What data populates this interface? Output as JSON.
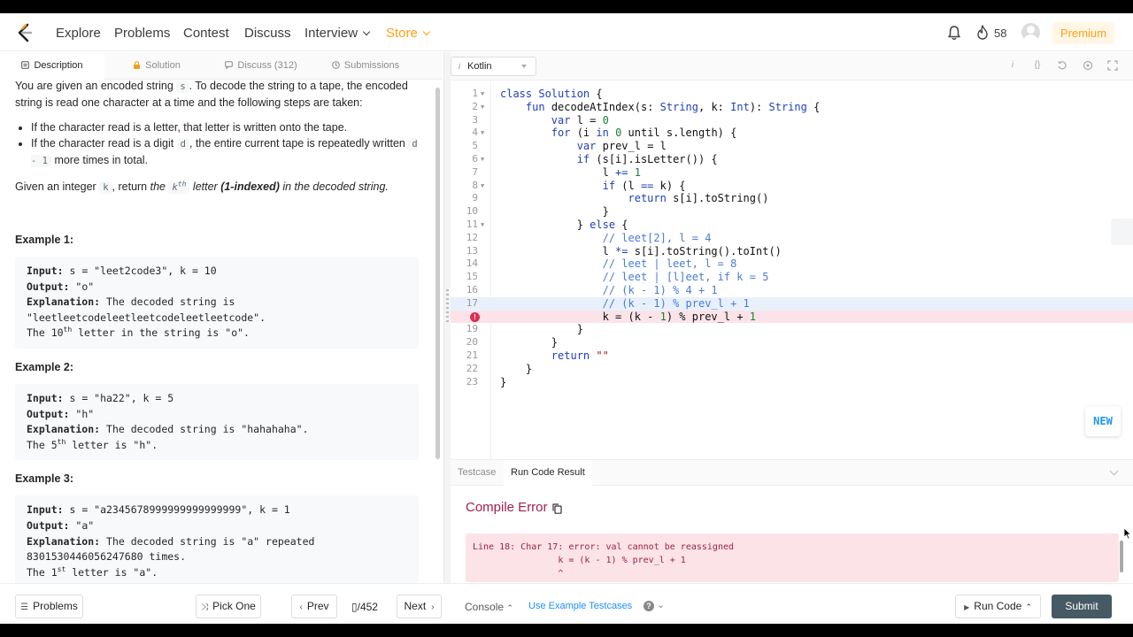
{
  "nav": {
    "links": [
      "Explore",
      "Problems",
      "Contest",
      "Discuss",
      "Interview",
      "Store"
    ],
    "streak": "58",
    "premium": "Premium",
    "brand_color": "#ffa116"
  },
  "left_tabs": [
    "Description",
    "Solution",
    "Discuss (312)",
    "Submissions"
  ],
  "description": {
    "p1a": "You are given an encoded string ",
    "p1code": "s",
    "p1b": ". To decode the string to a tape, the encoded string is read one character at a time and the following steps are taken:",
    "rule1": "If the character read is a letter, that letter is written onto the tape.",
    "rule2a": "If the character read is a digit ",
    "rule2code": "d",
    "rule2b": ", the entire current tape is repeatedly written ",
    "rule2code2": "d - 1",
    "rule2c": " more times in total.",
    "p2a": "Given an integer ",
    "p2code": "k",
    "p2b": ", return ",
    "p2c": "the ",
    "p2code2": "k",
    "p2sup": "th",
    "p2d": " letter ",
    "p2e": "(1-indexed)",
    "p2f": " in the decoded string."
  },
  "examples": [
    {
      "title": "Example 1:",
      "input_label": "Input:",
      "input": " s = \"leet2code3\", k = 10",
      "output_label": "Output:",
      "output": " \"o\"",
      "expl_label": "Explanation:",
      "expl": " The decoded string is",
      "expl2": "\"leetleetcodeleetleetcodeleetleetcode\".",
      "last_a": "The 10",
      "last_sup": "th",
      "last_b": " letter in the string is \"o\"."
    },
    {
      "title": "Example 2:",
      "input_label": "Input:",
      "input": " s = \"ha22\", k = 5",
      "output_label": "Output:",
      "output": " \"h\"",
      "expl_label": "Explanation:",
      "expl": " The decoded string is \"hahahaha\".",
      "last_a": "The 5",
      "last_sup": "th",
      "last_b": " letter is \"h\"."
    },
    {
      "title": "Example 3:",
      "input_label": "Input:",
      "input": " s = \"a2345678999999999999999\", k = 1",
      "output_label": "Output:",
      "output": " \"a\"",
      "expl_label": "Explanation:",
      "expl": " The decoded string is \"a\" repeated",
      "expl2": "8301530446056247680 times.",
      "last_a": "The 1",
      "last_sup": "st",
      "last_b": " letter is \"a\"."
    }
  ],
  "editor": {
    "language": "Kotlin",
    "lines": [
      {
        "n": "1",
        "fold": true,
        "html": "<span class=\"kw\">class</span> <span class=\"ty\">Solution</span> {"
      },
      {
        "n": "2",
        "fold": true,
        "html": "    <span class=\"kw\">fun</span> decodeAtIndex(s: <span class=\"ty\">String</span>, k: <span class=\"ty\">Int</span>): <span class=\"ty\">String</span> {"
      },
      {
        "n": "3",
        "fold": false,
        "html": "        <span class=\"kw\">var</span> l = <span class=\"num\">0</span>"
      },
      {
        "n": "4",
        "fold": true,
        "html": "        <span class=\"kw\">for</span> (i <span class=\"kw\">in</span> <span class=\"num\">0</span> until s.length) {"
      },
      {
        "n": "5",
        "fold": false,
        "html": "            <span class=\"kw\">var</span> prev_l = l"
      },
      {
        "n": "6",
        "fold": true,
        "html": "            <span class=\"kw\">if</span> (s[i].isLetter()) {"
      },
      {
        "n": "7",
        "fold": false,
        "html": "                l <span class=\"op\">+=</span> <span class=\"num\">1</span>"
      },
      {
        "n": "8",
        "fold": true,
        "html": "                <span class=\"kw\">if</span> (l <span class=\"op\">==</span> k) {"
      },
      {
        "n": "9",
        "fold": false,
        "html": "                    <span class=\"kw\">return</span> s[i].toString()"
      },
      {
        "n": "10",
        "fold": false,
        "html": "                }"
      },
      {
        "n": "11",
        "fold": true,
        "html": "            } <span class=\"kw\">else</span> {"
      },
      {
        "n": "12",
        "fold": false,
        "html": "                <span class=\"cm\">// leet[2], l = 4</span>"
      },
      {
        "n": "13",
        "fold": false,
        "html": "                l <span class=\"op\">*=</span> s[i].toString().toInt()"
      },
      {
        "n": "14",
        "fold": false,
        "html": "                <span class=\"cm\">// leet | leet, l = 8</span>"
      },
      {
        "n": "15",
        "fold": false,
        "html": "                <span class=\"cm\">// leet | [l]eet, if k = 5</span>"
      },
      {
        "n": "16",
        "fold": false,
        "html": "                <span class=\"cm\">// (k - 1) % 4 + 1</span>"
      },
      {
        "n": "17",
        "fold": false,
        "html": "                <span class=\"cm\">// (k - 1) % prev_l + 1</span>",
        "hl": "blue"
      },
      {
        "n": "",
        "fold": false,
        "html": "                k = (k - <span class=\"num\">1</span>) % prev_l + <span class=\"num\">1</span>",
        "hl": "red",
        "error": true
      },
      {
        "n": "19",
        "fold": false,
        "html": "            }"
      },
      {
        "n": "20",
        "fold": false,
        "html": "        }"
      },
      {
        "n": "21",
        "fold": false,
        "html": "        <span class=\"kw\">return</span> <span class=\"str\">\"\"</span>"
      },
      {
        "n": "22",
        "fold": false,
        "html": "    }"
      },
      {
        "n": "23",
        "fold": false,
        "html": "}"
      }
    ],
    "new_badge": "NEW"
  },
  "console": {
    "tabs": [
      "Testcase",
      "Run Code Result"
    ],
    "status": "Compile Error",
    "error_text": "Line 18: Char 17: error: val cannot be reassigned\n                k = (k - 1) % prev_l + 1\n                ^"
  },
  "bottom": {
    "problems": "Problems",
    "pick_one": "Pick One",
    "prev": "Prev",
    "pager": "/452",
    "next": "Next",
    "console": "Console",
    "use_example": "Use Example Testcases",
    "run_code": "Run Code",
    "submit": "Submit"
  }
}
